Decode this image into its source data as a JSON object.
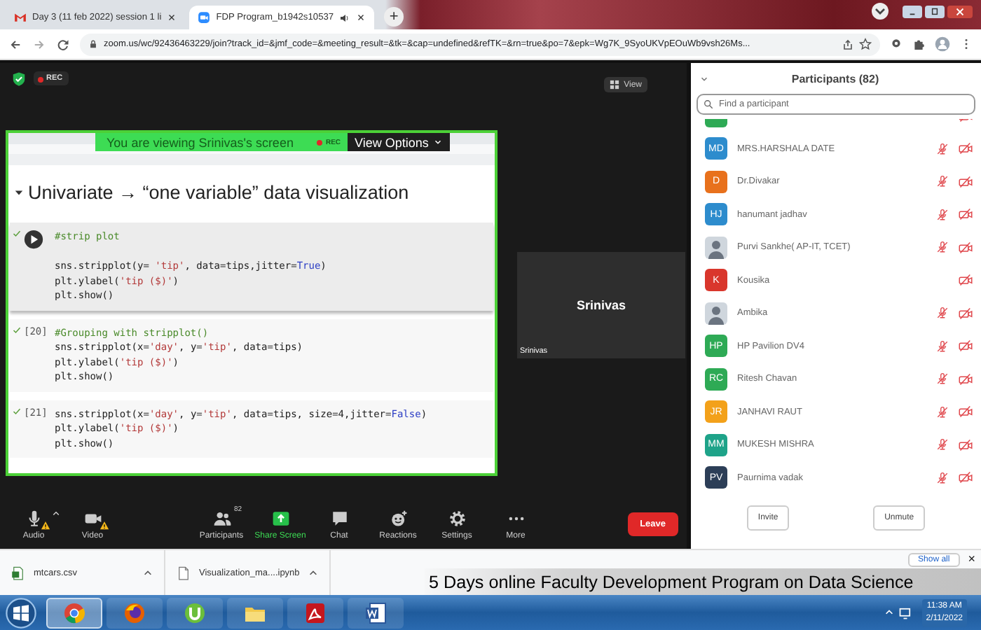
{
  "browser": {
    "tabs": [
      {
        "title": "Day 3 (11 feb 2022) session 1 li",
        "kind": "mail",
        "selected": false
      },
      {
        "title": "FDP Program_b1942s10537",
        "kind": "zoom",
        "selected": true,
        "audio": true
      }
    ],
    "new_tab": "+",
    "url": "zoom.us/wc/92436463229/join?track_id=&jmf_code=&meeting_result=&tk=&cap=undefined&refTK=&rn=true&po=7&epk=Wg7K_9SyoUKVpEOuWb9vsh26Ms..."
  },
  "meeting": {
    "recording_badge": "REC",
    "view_button": "View",
    "share_banner": {
      "text": "You are viewing Srinivas's screen",
      "rec": "REC",
      "view_options": "View Options"
    },
    "notebook": {
      "heading": "Univariate → “one variable” data visualization",
      "cells": [
        {
          "active": true,
          "executed": true,
          "gap_after_first": true,
          "lines": [
            "#strip plot",
            "sns.stripplot(y= 'tip', data=tips,jitter=True)",
            "plt.ylabel('tip ($)')",
            "plt.show()"
          ]
        },
        {
          "label": "[20]",
          "active": false,
          "executed": true,
          "gap_after_first": false,
          "lines": [
            "#Grouping with stripplot()",
            "sns.stripplot(x='day', y='tip', data=tips)",
            "plt.ylabel('tip ($)')",
            "plt.show()"
          ]
        },
        {
          "label": "[21]",
          "active": false,
          "executed": true,
          "gap_after_first": false,
          "lines": [
            "sns.stripplot(x='day', y='tip', data=tips, size=4,jitter=False)",
            "plt.ylabel('tip ($)')",
            "plt.show()"
          ]
        }
      ]
    },
    "video_tile": {
      "name": "Srinivas",
      "caption": "Srinivas"
    }
  },
  "participants": {
    "title": "Participants (82)",
    "search": {
      "placeholder": "Find a participant"
    },
    "items": [
      {
        "kind": "initials",
        "color": "#2eaa55",
        "video_off": true
      },
      {
        "kind": "initials",
        "name": "MRS.HARSHALA DATE",
        "initials": "MD",
        "color": "#2d8ccd",
        "audio_muted": true,
        "video_off": true
      },
      {
        "kind": "initials",
        "name": "Dr.Divakar",
        "initials": "D",
        "color": "#e8711c",
        "audio_muted": true,
        "video_off": true
      },
      {
        "kind": "initials",
        "name": "hanumant jadhav",
        "initials": "HJ",
        "color": "#2d8ccd",
        "audio_muted": true,
        "video_off": true
      },
      {
        "kind": "photo",
        "name": "Purvi Sankhe( AP-IT, TCET)",
        "audio_muted": true,
        "video_off": true
      },
      {
        "kind": "initials",
        "name": "Kousika",
        "initials": "K",
        "color": "#d9362c",
        "audio_muted": false,
        "video_off": true
      },
      {
        "kind": "photo",
        "name": "Ambika",
        "audio_muted": true,
        "video_off": true
      },
      {
        "kind": "initials",
        "name": "HP Pavilion DV4",
        "initials": "HP",
        "color": "#2eaa55",
        "audio_muted": true,
        "video_off": true
      },
      {
        "kind": "initials",
        "name": "Ritesh Chavan",
        "initials": "RC",
        "color": "#2eaa55",
        "audio_muted": true,
        "video_off": true
      },
      {
        "kind": "initials",
        "name": "JANHAVI RAUT",
        "initials": "JR",
        "color": "#f3a11a",
        "audio_muted": true,
        "video_off": true
      },
      {
        "kind": "initials",
        "name": "MUKESH MISHRA",
        "initials": "MM",
        "color": "#1ea389",
        "audio_muted": true,
        "video_off": true
      },
      {
        "kind": "initials",
        "name": "Paurnima vadak",
        "initials": "PV",
        "color": "#2c3e57",
        "audio_muted": true,
        "video_off": true
      }
    ],
    "buttons": [
      "Invite",
      "Unmute"
    ]
  },
  "toolbar": {
    "items": [
      {
        "label": "Audio",
        "kind": "mic",
        "warning": true,
        "caret": true
      },
      {
        "label": "Video",
        "kind": "camera",
        "warning": true,
        "caret": false
      },
      {
        "label": "Participants",
        "kind": "people",
        "count": "82"
      },
      {
        "label": "Share Screen",
        "kind": "share"
      },
      {
        "label": "Chat",
        "kind": "chat"
      },
      {
        "label": "Reactions",
        "kind": "reactions"
      },
      {
        "label": "Settings",
        "kind": "gear"
      },
      {
        "label": "More",
        "kind": "more"
      }
    ],
    "leave": "Leave"
  },
  "downloads": {
    "items": [
      {
        "name": "mtcars.csv",
        "kind": "csv"
      },
      {
        "name": "Visualization_ma....ipynb",
        "kind": "file"
      }
    ],
    "show_all": "Show all",
    "close": "×"
  },
  "caption": "5 Days online Faculty Development Program on Data Science",
  "taskbar": {
    "apps": [
      {
        "kind": "chrome",
        "selected": true
      },
      {
        "kind": "firefox",
        "selected": false
      },
      {
        "kind": "torrent",
        "selected": false
      },
      {
        "kind": "explorer",
        "selected": false
      },
      {
        "kind": "acrobat",
        "selected": false
      },
      {
        "kind": "word",
        "selected": false
      }
    ],
    "time": "11:38 AM",
    "date": "2/11/2022"
  }
}
